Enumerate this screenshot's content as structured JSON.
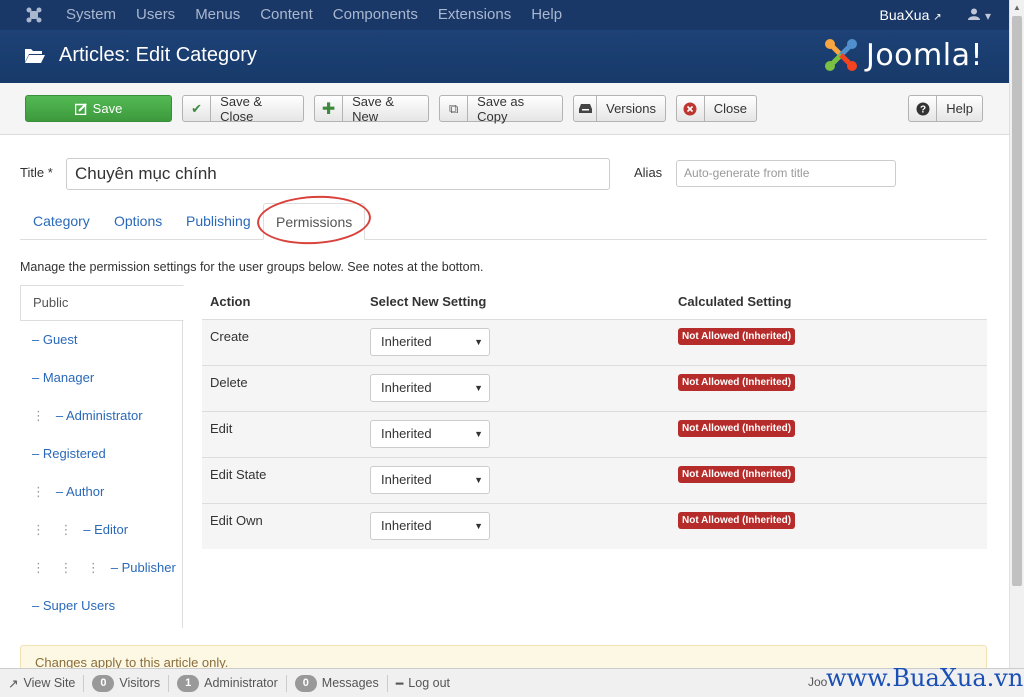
{
  "topnav": {
    "menu": [
      "System",
      "Users",
      "Menus",
      "Content",
      "Components",
      "Extensions",
      "Help"
    ],
    "user": "BuaXua",
    "user_icon": "user-icon"
  },
  "header": {
    "title": "Articles: Edit Category",
    "brand": "Joomla!"
  },
  "toolbar": {
    "save": "Save",
    "save_close": "Save & Close",
    "save_new": "Save & New",
    "save_copy": "Save as Copy",
    "versions": "Versions",
    "close": "Close",
    "help": "Help"
  },
  "form": {
    "title_label": "Title *",
    "title_value": "Chuyên mục chính",
    "alias_label": "Alias",
    "alias_placeholder": "Auto-generate from title"
  },
  "tabs": [
    "Category",
    "Options",
    "Publishing",
    "Permissions"
  ],
  "active_tab": "Permissions",
  "permissions": {
    "description": "Manage the permission settings for the user groups below. See notes at the bottom.",
    "groups": [
      {
        "label": "Public",
        "prefix": ""
      },
      {
        "label": "– Guest",
        "prefix": ""
      },
      {
        "label": "– Manager",
        "prefix": ""
      },
      {
        "label": "– Administrator",
        "prefix": "⋮"
      },
      {
        "label": "– Registered",
        "prefix": ""
      },
      {
        "label": "– Author",
        "prefix": "⋮"
      },
      {
        "label": "– Editor",
        "prefix": "⋮    ⋮"
      },
      {
        "label": "– Publisher",
        "prefix": "⋮    ⋮    ⋮"
      },
      {
        "label": "– Super Users",
        "prefix": ""
      }
    ],
    "headers": {
      "action": "Action",
      "select": "Select New Setting",
      "calculated": "Calculated Setting"
    },
    "rows": [
      {
        "action": "Create",
        "setting": "Inherited",
        "calculated": "Not Allowed (Inherited)"
      },
      {
        "action": "Delete",
        "setting": "Inherited",
        "calculated": "Not Allowed (Inherited)"
      },
      {
        "action": "Edit",
        "setting": "Inherited",
        "calculated": "Not Allowed (Inherited)"
      },
      {
        "action": "Edit State",
        "setting": "Inherited",
        "calculated": "Not Allowed (Inherited)"
      },
      {
        "action": "Edit Own",
        "setting": "Inherited",
        "calculated": "Not Allowed (Inherited)"
      }
    ],
    "notice": "Changes apply to this article only."
  },
  "statusbar": {
    "view_site": "View Site",
    "visitors_count": "0",
    "visitors": "Visitors",
    "admin_count": "1",
    "administrator": "Administrator",
    "messages_count": "0",
    "messages": "Messages",
    "logout": "Log out",
    "right_text": "Joo"
  },
  "watermark": "www.BuaXua.vn",
  "colors": {
    "navbar": "#1a3867",
    "header": "#1c3d6e",
    "save_button": "#46a546",
    "link": "#2a69b8",
    "badge_danger": "#b52c2a",
    "annotation_circle": "#d9413b"
  }
}
